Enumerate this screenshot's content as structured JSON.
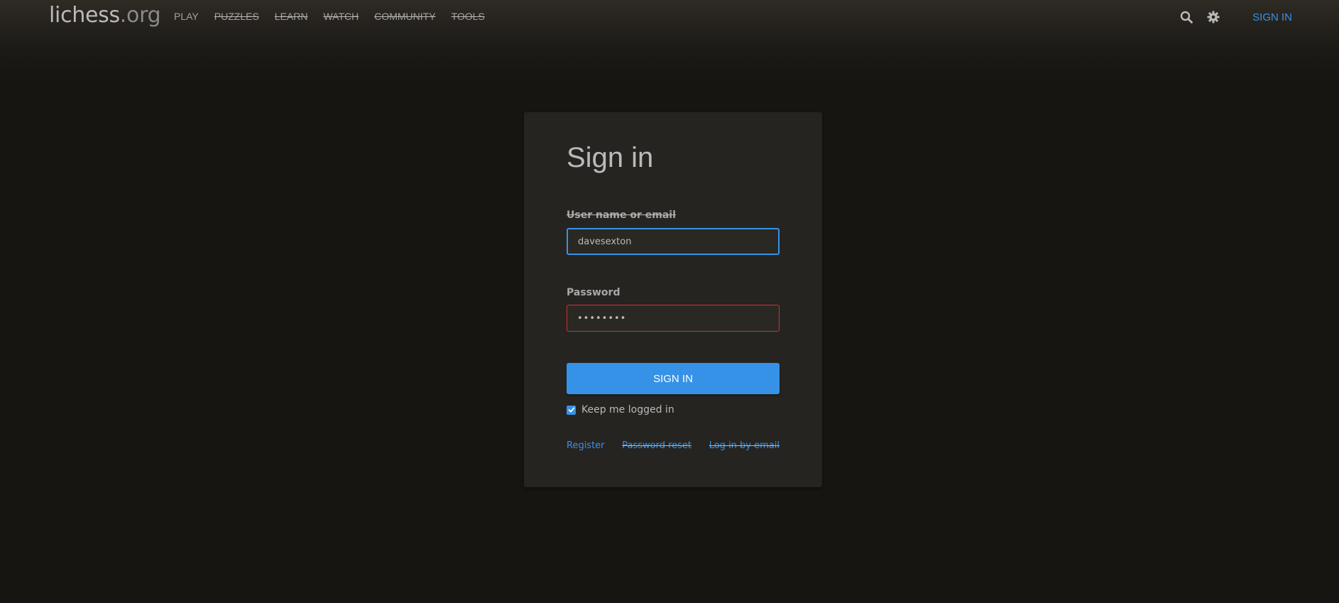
{
  "header": {
    "logo_main": "lichess",
    "logo_suffix": ".org",
    "nav": [
      {
        "label": "PLAY"
      },
      {
        "label": "PUZZLES"
      },
      {
        "label": "LEARN"
      },
      {
        "label": "WATCH"
      },
      {
        "label": "COMMUNITY"
      },
      {
        "label": "TOOLS"
      }
    ],
    "search_icon": "search-icon",
    "settings_icon": "gear-icon",
    "signin_label": "SIGN IN"
  },
  "form": {
    "title": "Sign in",
    "username_label": "User name or email",
    "username_value": "davesexton",
    "password_label": "Password",
    "password_value": "••••••••",
    "submit_label": "SIGN IN",
    "remember_label": "Keep me logged in",
    "remember_checked": true,
    "links": {
      "register": "Register",
      "password_reset": "Password reset",
      "login_by_email": "Log in by email"
    }
  },
  "colors": {
    "background": "#161512",
    "card": "#262421",
    "accent": "#3692e7",
    "error_border": "#cc3333",
    "text": "#bababa"
  }
}
